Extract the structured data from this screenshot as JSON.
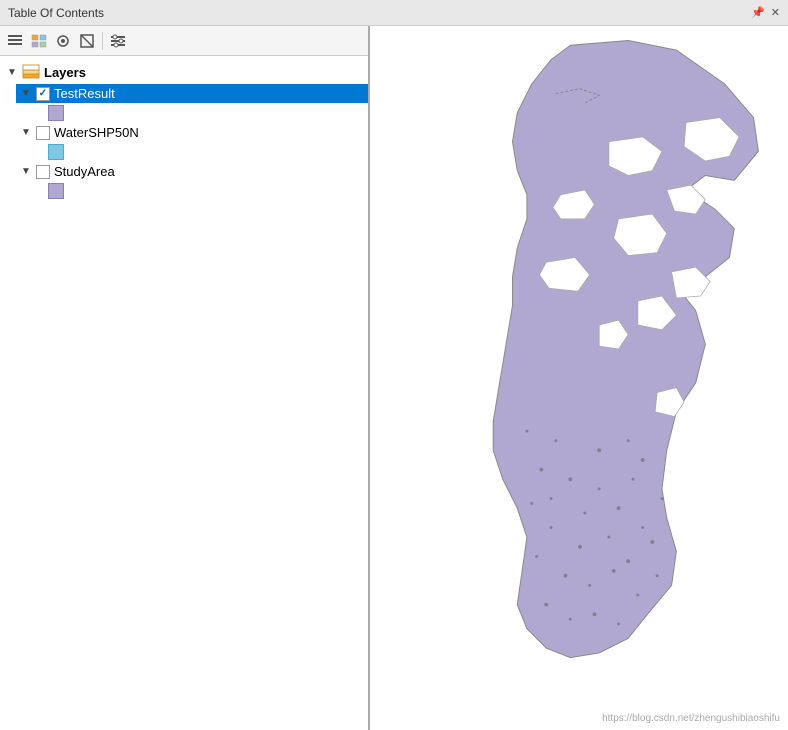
{
  "title_bar": {
    "title": "Table Of Contents",
    "pin_label": "pin",
    "close_label": "close"
  },
  "toolbar": {
    "btn1_label": "list-view",
    "btn2_label": "layer-view",
    "btn3_label": "source-view",
    "btn4_label": "visibility-view",
    "btn5_label": "options"
  },
  "layers_root": {
    "label": "Layers",
    "icon": "layers-icon"
  },
  "layers": [
    {
      "name": "TestResult",
      "checked": true,
      "selected": true,
      "symbol_color": "#b0a8d0",
      "expanded": true
    },
    {
      "name": "WaterSHP50N",
      "checked": false,
      "selected": false,
      "symbol_color": "#7ec8e3",
      "expanded": true
    },
    {
      "name": "StudyArea",
      "checked": false,
      "selected": false,
      "symbol_color": "#b0a8d0",
      "expanded": true
    }
  ],
  "watermark": "https://blog.csdn.net/zhengushibiaoshifu"
}
